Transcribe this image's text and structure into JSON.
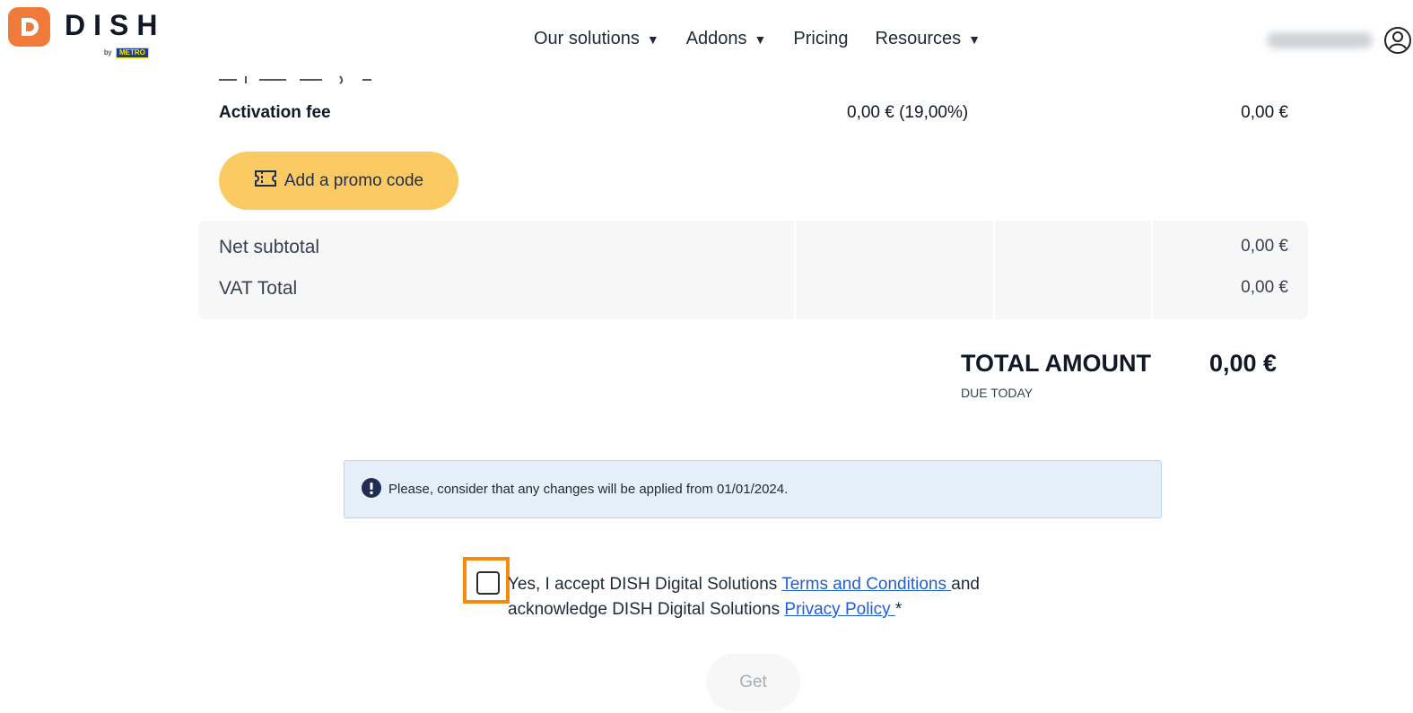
{
  "header": {
    "logo_text": "DISH",
    "logo_by": "by",
    "logo_metro": "METRO",
    "nav": [
      {
        "label": "Our solutions",
        "has_dropdown": true
      },
      {
        "label": "Addons",
        "has_dropdown": true
      },
      {
        "label": "Pricing",
        "has_dropdown": false
      },
      {
        "label": "Resources",
        "has_dropdown": true
      }
    ],
    "caret": "▼",
    "user_icon": "user-circle-icon"
  },
  "order": {
    "activation": {
      "label": "Activation fee",
      "vat": "0,00 € (19,00%)",
      "amount": "0,00 €"
    },
    "promo_button": "Add a promo code",
    "net_subtotal": {
      "label": "Net subtotal",
      "amount": "0,00 €"
    },
    "vat_total": {
      "label": "VAT Total",
      "amount": "0,00 €"
    },
    "total": {
      "label": "TOTAL AMOUNT",
      "value": "0,00 €",
      "sub": "DUE TODAY"
    }
  },
  "notice": {
    "icon": "info-icon",
    "text": "Please, consider that any changes will be applied from 01/01/2024."
  },
  "consent": {
    "part1": "Yes, I accept DISH Digital Solutions ",
    "terms_link": "Terms and Conditions ",
    "part2": "and acknowledge DISH Digital Solutions ",
    "privacy_link": "Privacy Policy ",
    "required": "*"
  },
  "get_button": "Get",
  "colors": {
    "brand_orange": "#f07a3a",
    "promo_yellow": "#fbca63",
    "link_blue": "#1d5fd6",
    "highlight_orange": "#f58a0b",
    "notice_bg": "#e4eff9"
  }
}
